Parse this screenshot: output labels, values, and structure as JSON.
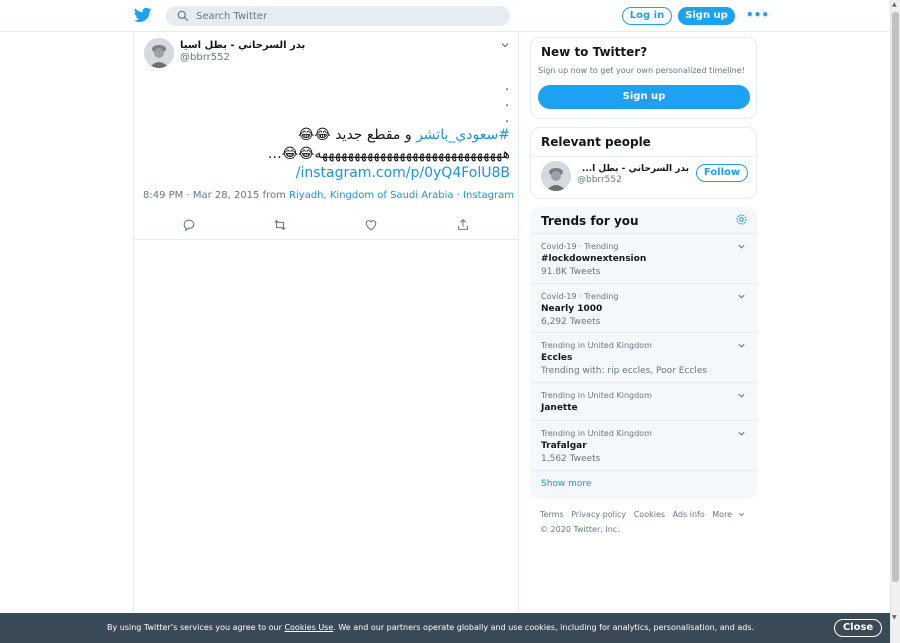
{
  "header": {
    "search_placeholder": "Search Twitter",
    "login_label": "Log in",
    "signup_label": "Sign up",
    "more_label": "•••"
  },
  "tweet": {
    "author_name": "بدر السرحاني - بطل اسيا",
    "author_handle": "@bbrr552",
    "dots": [
      ".",
      ".",
      "."
    ],
    "hashtag": "#سعودي_باتشر",
    "text_after_hashtag": " و مقطع جديد 😂😂",
    "line2": "هههههههههههههههههههههههههههههه😂😂…",
    "link": "instagram.com/p/0yQ4FolU8B/",
    "timestamp": "8:49 PM · Mar 28, 2015 from ",
    "location": "Riyadh, Kingdom of Saudi Arabia",
    "separator": " · ",
    "source": "Instagram"
  },
  "new_to_twitter": {
    "title": "New to Twitter?",
    "subtitle": "Sign up now to get your own personalized timeline!",
    "signup_label": "Sign up"
  },
  "relevant_people": {
    "title": "Relevant people",
    "name": "بدر السرحاني - بطل ا...",
    "handle": "@bbrr552",
    "follow_label": "Follow"
  },
  "trends": {
    "title": "Trends for you",
    "items": [
      {
        "context": "Covid-19 · Trending",
        "name": "#lockdownextension",
        "sub": "91.8K Tweets"
      },
      {
        "context": "Covid-19 · Trending",
        "name": "Nearly 1000",
        "sub": "6,292 Tweets"
      },
      {
        "context": "Trending in United Kingdom",
        "name": "Eccles",
        "sub": "Trending with: rip eccles, Poor Eccles"
      },
      {
        "context": "Trending in United Kingdom",
        "name": "Janette",
        "sub": ""
      },
      {
        "context": "Trending in United Kingdom",
        "name": "Trafalgar",
        "sub": "1,562 Tweets"
      }
    ],
    "show_more": "Show more"
  },
  "footer": {
    "links": [
      "Terms",
      "Privacy policy",
      "Cookies",
      "Ads info",
      "More"
    ],
    "copyright": "© 2020 Twitter, Inc."
  },
  "cookie_bar": {
    "text_before": "By using Twitter’s services you agree to our ",
    "link": "Cookies Use",
    "text_after": ". We and our partners operate globally and use cookies, including for analytics, personalisation, and ads.",
    "close_label": "Close"
  },
  "colors": {
    "accent": "#1da1f2",
    "link": "#1b95e0",
    "cookie_bar": "#3b4a57",
    "muted": "#657786"
  }
}
